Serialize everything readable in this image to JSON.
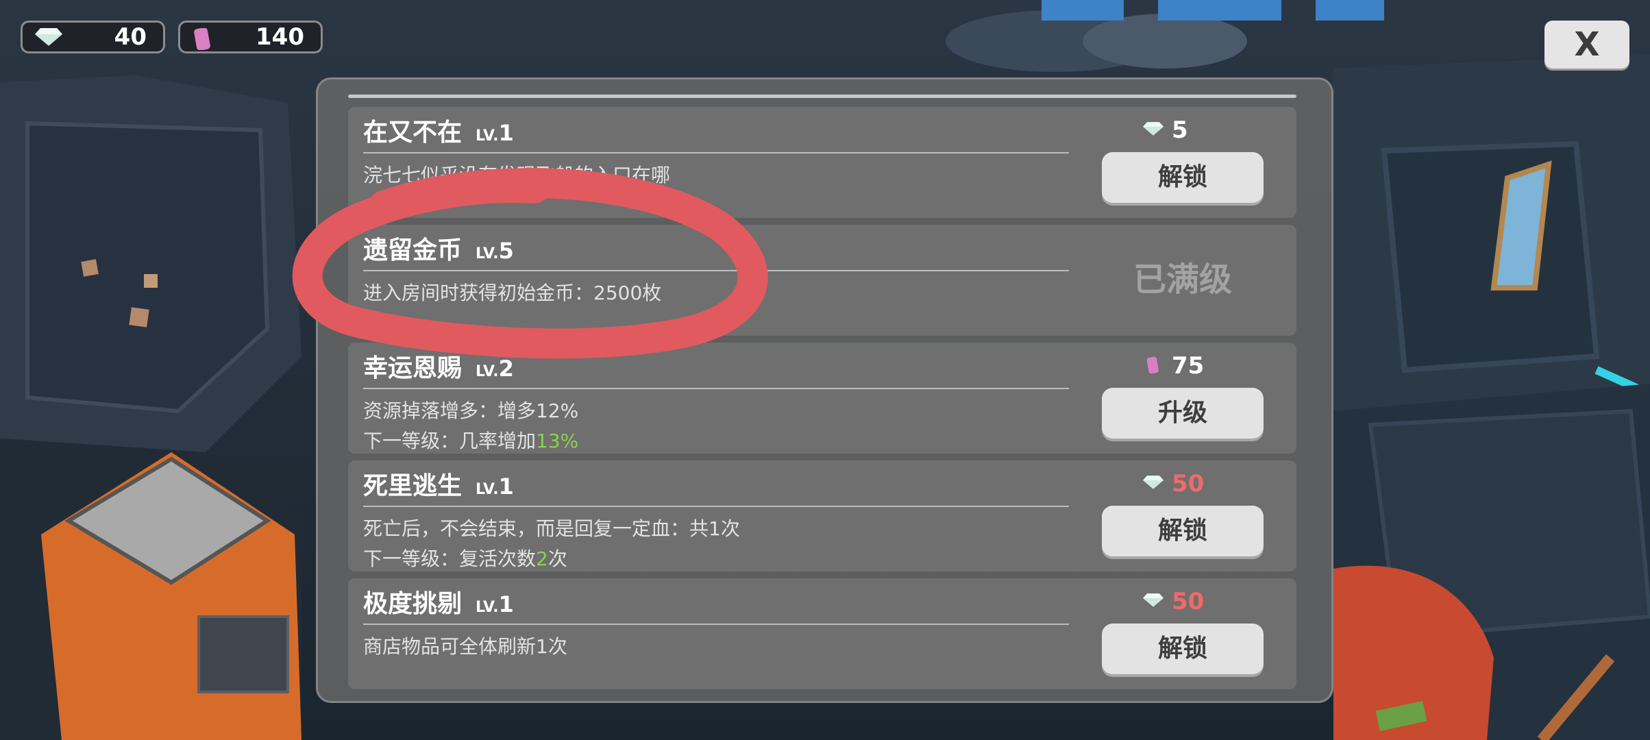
{
  "currency": {
    "gems": "40",
    "tickets": "140"
  },
  "close_label": "X",
  "cards": [
    {
      "name": "在又不在",
      "lv_prefix": "LV.",
      "lv": "1",
      "desc": "浣七七似乎没有发现飞船的入口在哪",
      "cost_icon": "gem-icon",
      "cost": "5",
      "button": "解锁"
    },
    {
      "name": "遗留金币",
      "lv_prefix": "LV.",
      "lv": "5",
      "desc": "进入房间时获得初始金币：2500枚",
      "status": "已满级"
    },
    {
      "name": "幸运恩赐",
      "lv_prefix": "LV.",
      "lv": "2",
      "desc": "资源掉落增多：增多12%",
      "next_prefix": "下一等级：几率增加",
      "next_value": "13%",
      "next_suffix": "",
      "cost_icon": "ticket-icon",
      "cost": "75",
      "button": "升级"
    },
    {
      "name": "死里逃生",
      "lv_prefix": "LV.",
      "lv": "1",
      "desc": "死亡后，不会结束，而是回复一定血：共1次",
      "next_prefix": "下一等级：复活次数",
      "next_value": "2",
      "next_suffix": "次",
      "cost_icon": "gem-icon",
      "cost": "50",
      "button": "解锁"
    },
    {
      "name": "极度挑剔",
      "lv_prefix": "LV.",
      "lv": "1",
      "desc": "商店物品可全体刷新1次",
      "cost_icon": "gem-icon",
      "cost": "50",
      "button": "解锁"
    }
  ],
  "colors": {
    "highlight_green": "#8bd24a",
    "insufficient_red": "#f06a6a",
    "annotation_red": "#e05a60"
  }
}
